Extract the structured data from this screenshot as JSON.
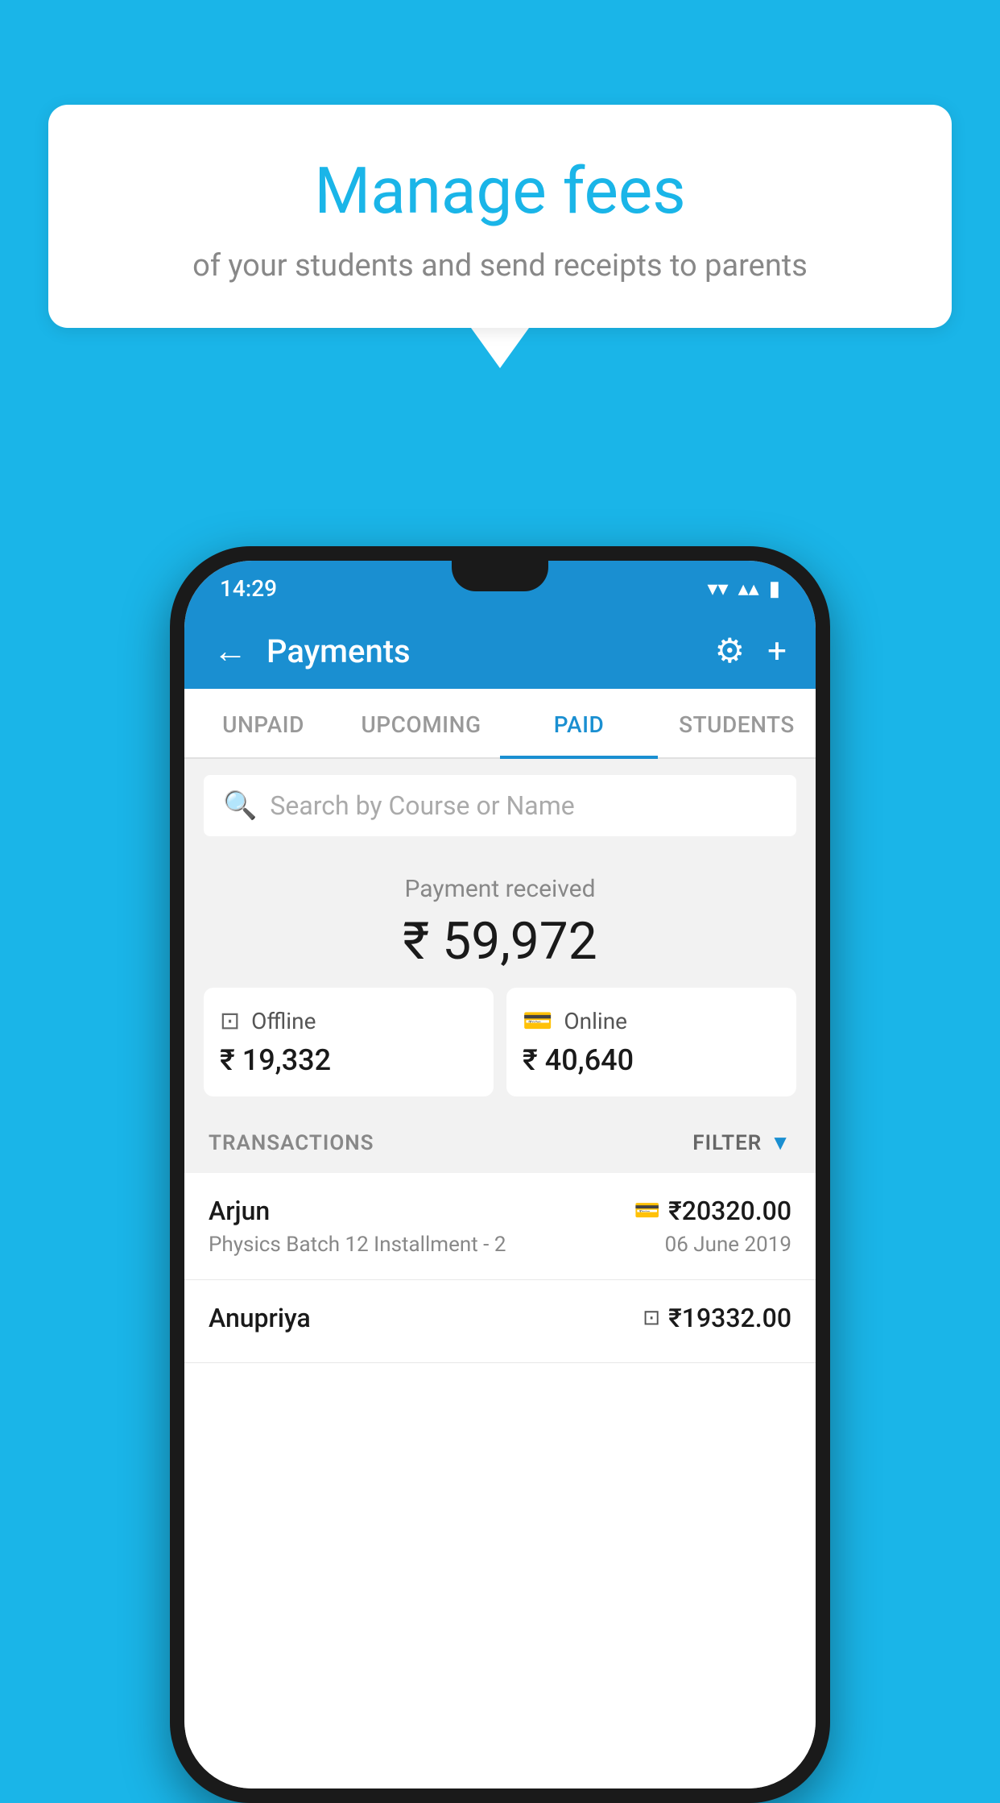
{
  "background_color": "#1ab5e8",
  "bubble": {
    "title": "Manage fees",
    "subtitle": "of your students and send receipts to parents"
  },
  "status_bar": {
    "time": "14:29",
    "wifi": "▲",
    "signal": "▲",
    "battery": "▓"
  },
  "header": {
    "title": "Payments",
    "back_label": "←",
    "settings_label": "⚙",
    "add_label": "+"
  },
  "tabs": [
    {
      "id": "unpaid",
      "label": "UNPAID",
      "active": false
    },
    {
      "id": "upcoming",
      "label": "UPCOMING",
      "active": false
    },
    {
      "id": "paid",
      "label": "PAID",
      "active": true
    },
    {
      "id": "students",
      "label": "STUDENTS",
      "active": false
    }
  ],
  "search": {
    "placeholder": "Search by Course or Name"
  },
  "payment_summary": {
    "received_label": "Payment received",
    "total_amount": "₹ 59,972",
    "offline": {
      "label": "Offline",
      "amount": "₹ 19,332"
    },
    "online": {
      "label": "Online",
      "amount": "₹ 40,640"
    }
  },
  "transactions": {
    "header_label": "TRANSACTIONS",
    "filter_label": "FILTER",
    "items": [
      {
        "name": "Arjun",
        "payment_mode": "card",
        "amount": "₹20320.00",
        "detail": "Physics Batch 12 Installment - 2",
        "date": "06 June 2019"
      },
      {
        "name": "Anupriya",
        "payment_mode": "cash",
        "amount": "₹19332.00",
        "detail": "",
        "date": ""
      }
    ]
  }
}
